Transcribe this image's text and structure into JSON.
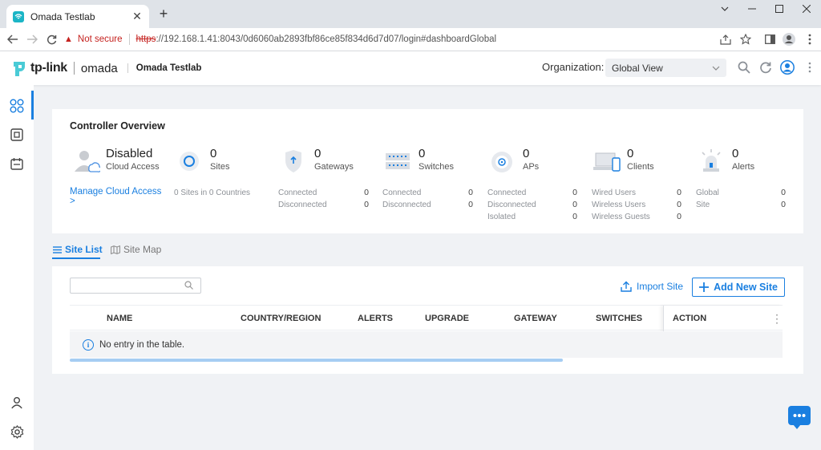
{
  "browser": {
    "tab_title": "Omada Testlab",
    "security_label": "Not secure",
    "url_scheme": "https",
    "url_rest": "://192.168.1.41:8043/0d6060ab2893fbf86ce85f834d6d7d07/login#dashboardGlobal"
  },
  "header": {
    "brand": "tp-link",
    "product": "omada",
    "site_name": "Omada Testlab",
    "org_label": "Organization:",
    "org_value": "Global View"
  },
  "overview": {
    "title": "Controller Overview",
    "cloud": {
      "status": "Disabled",
      "label": "Cloud Access",
      "link": "Manage Cloud Access",
      "link_arrow": ">"
    },
    "sites": {
      "count": "0",
      "label": "Sites",
      "detail": "0 Sites in 0 Countries"
    },
    "gateways": {
      "count": "0",
      "label": "Gateways",
      "rows": [
        {
          "label": "Connected",
          "value": "0"
        },
        {
          "label": "Disconnected",
          "value": "0"
        }
      ]
    },
    "switches": {
      "count": "0",
      "label": "Switches",
      "rows": [
        {
          "label": "Connected",
          "value": "0"
        },
        {
          "label": "Disconnected",
          "value": "0"
        }
      ]
    },
    "aps": {
      "count": "0",
      "label": "APs",
      "rows": [
        {
          "label": "Connected",
          "value": "0"
        },
        {
          "label": "Disconnected",
          "value": "0"
        },
        {
          "label": "Isolated",
          "value": "0"
        }
      ]
    },
    "clients": {
      "count": "0",
      "label": "Clients",
      "rows": [
        {
          "label": "Wired Users",
          "value": "0"
        },
        {
          "label": "Wireless Users",
          "value": "0"
        },
        {
          "label": "Wireless Guests",
          "value": "0"
        }
      ]
    },
    "alerts": {
      "count": "0",
      "label": "Alerts",
      "rows": [
        {
          "label": "Global",
          "value": "0"
        },
        {
          "label": "Site",
          "value": "0"
        }
      ]
    }
  },
  "tabs": {
    "site_list": "Site List",
    "site_map": "Site Map"
  },
  "table": {
    "search_placeholder": "",
    "import_label": "Import Site",
    "add_label": "Add New Site",
    "columns": [
      "NAME",
      "COUNTRY/REGION",
      "ALERTS",
      "UPGRADE",
      "GATEWAY",
      "SWITCHES",
      "ACTION"
    ],
    "empty_text": "No entry in the table."
  },
  "colors": {
    "accent": "#1a7fe0",
    "warn": "#c5221f",
    "teal": "#1bb5c6"
  }
}
